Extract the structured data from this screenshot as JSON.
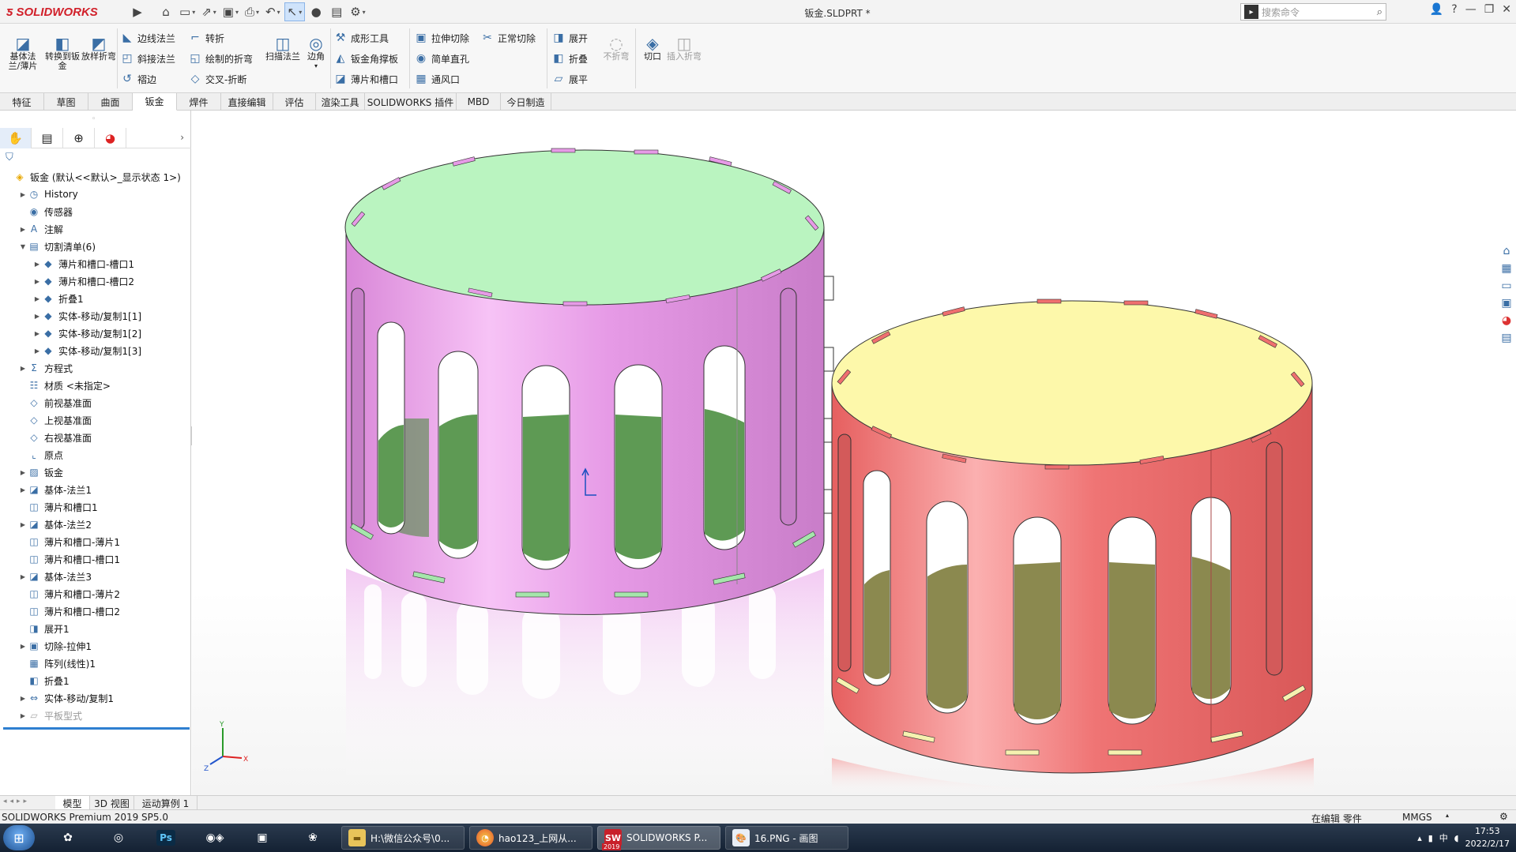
{
  "app": {
    "brand": "SOLIDWORKS",
    "doc_title": "钣金.SLDPRT *"
  },
  "search": {
    "placeholder": "搜索命令"
  },
  "ribbon": {
    "big_left": [
      {
        "label": "基体法兰/薄片"
      },
      {
        "label": "转换到钣金"
      },
      {
        "label": "放样折弯"
      }
    ],
    "col1": [
      "边线法兰",
      "斜接法兰",
      "褶边"
    ],
    "col2": [
      "转折",
      "绘制的折弯",
      "交叉-折断"
    ],
    "scan": "扫描法兰",
    "corner": "边角",
    "col3": [
      "成形工具",
      "钣金角撑板",
      "薄片和槽口"
    ],
    "col4": [
      "拉伸切除",
      "简单直孔",
      "通风口"
    ],
    "normal_cut": "正常切除",
    "col5": [
      "展开",
      "折叠",
      "展平"
    ],
    "no_bend": "不折弯",
    "rip": "切口",
    "insert_bends": "插入折弯"
  },
  "tabs": [
    "特征",
    "草图",
    "曲面",
    "钣金",
    "焊件",
    "直接编辑",
    "评估",
    "渲染工具",
    "SOLIDWORKS 插件",
    "MBD",
    "今日制造"
  ],
  "active_tab": "钣金",
  "tree": [
    {
      "label": "钣金 (默认<<默认>_显示状态 1>)",
      "icon": "part-icon",
      "depth": 0,
      "exp": ""
    },
    {
      "label": "History",
      "icon": "history-icon",
      "depth": 1,
      "exp": "▶"
    },
    {
      "label": "传感器",
      "icon": "sensor-icon",
      "depth": 1,
      "exp": ""
    },
    {
      "label": "注解",
      "icon": "annotation-icon",
      "depth": 1,
      "exp": "▶"
    },
    {
      "label": "切割清单(6)",
      "icon": "cutlist-icon",
      "depth": 1,
      "exp": "▼"
    },
    {
      "label": "薄片和槽口-槽口1",
      "icon": "body-icon",
      "depth": 2,
      "exp": "▶"
    },
    {
      "label": "薄片和槽口-槽口2",
      "icon": "body-icon",
      "depth": 2,
      "exp": "▶"
    },
    {
      "label": "折叠1",
      "icon": "body-icon",
      "depth": 2,
      "exp": "▶"
    },
    {
      "label": "实体-移动/复制1[1]",
      "icon": "body-icon",
      "depth": 2,
      "exp": "▶"
    },
    {
      "label": "实体-移动/复制1[2]",
      "icon": "body-icon",
      "depth": 2,
      "exp": "▶"
    },
    {
      "label": "实体-移动/复制1[3]",
      "icon": "body-icon",
      "depth": 2,
      "exp": "▶"
    },
    {
      "label": "方程式",
      "icon": "equation-icon",
      "depth": 1,
      "exp": "▶"
    },
    {
      "label": "材质 <未指定>",
      "icon": "material-icon",
      "depth": 1,
      "exp": ""
    },
    {
      "label": "前视基准面",
      "icon": "plane-icon",
      "depth": 1,
      "exp": ""
    },
    {
      "label": "上视基准面",
      "icon": "plane-icon",
      "depth": 1,
      "exp": ""
    },
    {
      "label": "右视基准面",
      "icon": "plane-icon",
      "depth": 1,
      "exp": ""
    },
    {
      "label": "原点",
      "icon": "origin-icon",
      "depth": 1,
      "exp": ""
    },
    {
      "label": "钣金",
      "icon": "sheetmetal-icon",
      "depth": 1,
      "exp": "▶"
    },
    {
      "label": "基体-法兰1",
      "icon": "base-flange-icon",
      "depth": 1,
      "exp": "▶"
    },
    {
      "label": "薄片和槽口1",
      "icon": "tab-slot-icon",
      "depth": 1,
      "exp": ""
    },
    {
      "label": "基体-法兰2",
      "icon": "base-flange-icon",
      "depth": 1,
      "exp": "▶"
    },
    {
      "label": "薄片和槽口-薄片1",
      "icon": "tab-slot-icon",
      "depth": 1,
      "exp": ""
    },
    {
      "label": "薄片和槽口-槽口1",
      "icon": "tab-slot-icon",
      "depth": 1,
      "exp": ""
    },
    {
      "label": "基体-法兰3",
      "icon": "base-flange-icon",
      "depth": 1,
      "exp": "▶"
    },
    {
      "label": "薄片和槽口-薄片2",
      "icon": "tab-slot-icon",
      "depth": 1,
      "exp": ""
    },
    {
      "label": "薄片和槽口-槽口2",
      "icon": "tab-slot-icon",
      "depth": 1,
      "exp": ""
    },
    {
      "label": "展开1",
      "icon": "unfold-icon",
      "depth": 1,
      "exp": ""
    },
    {
      "label": "切除-拉伸1",
      "icon": "cut-extrude-icon",
      "depth": 1,
      "exp": "▶"
    },
    {
      "label": "阵列(线性)1",
      "icon": "pattern-icon",
      "depth": 1,
      "exp": ""
    },
    {
      "label": "折叠1",
      "icon": "fold-icon",
      "depth": 1,
      "exp": ""
    },
    {
      "label": "实体-移动/复制1",
      "icon": "move-body-icon",
      "depth": 1,
      "exp": "▶"
    },
    {
      "label": "平板型式",
      "icon": "flat-pattern-icon",
      "depth": 1,
      "exp": "▶",
      "grey": true
    }
  ],
  "bottom_tabs": [
    "模型",
    "3D 视图",
    "运动算例 1"
  ],
  "active_bottom_tab": "模型",
  "status": {
    "left": "SOLIDWORKS Premium 2019 SP5.0",
    "mode": "在编辑 零件",
    "units": "MMGS"
  },
  "taskbar": {
    "apps": [
      {
        "label": "H:\\微信公众号\\0...",
        "icon": "folder-icon"
      },
      {
        "label": "hao123_上网从...",
        "icon": "browser-icon"
      },
      {
        "label": "SOLIDWORKS P...",
        "icon": "solidworks-icon",
        "badge": "2019"
      },
      {
        "label": "16.PNG - 画图",
        "icon": "paint-icon"
      }
    ],
    "time": "17:53",
    "date": "2022/2/17"
  },
  "triad": {
    "x": "X",
    "y": "Y",
    "z": "Z"
  },
  "colors": {
    "pink_body": "#e79be6",
    "pink_top": "#b9f4bf",
    "red_body": "#ef6f6f",
    "red_top": "#fdf7a8",
    "accent": "#2f7fd1"
  }
}
